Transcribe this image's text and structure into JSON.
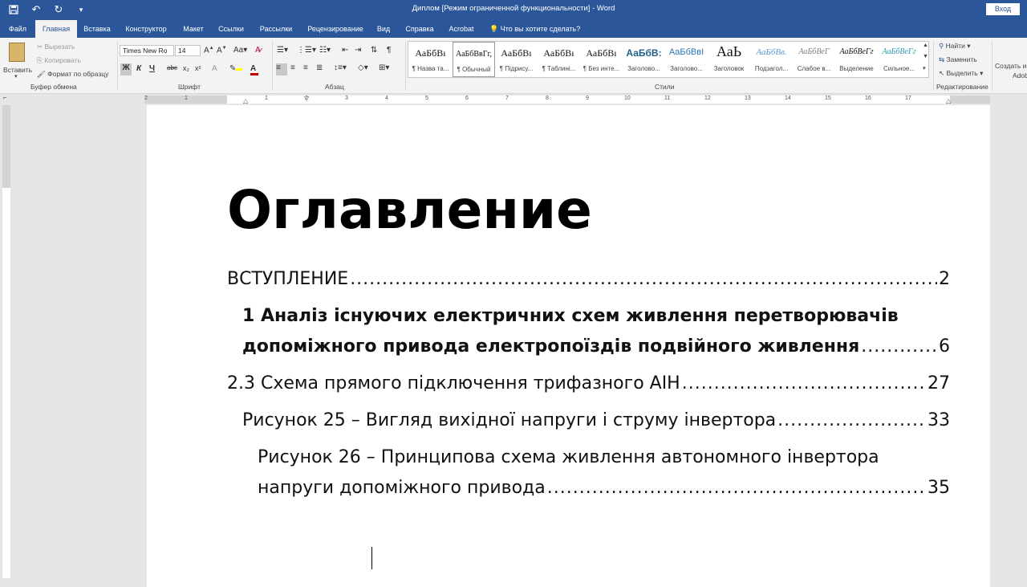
{
  "window": {
    "title": "Диплом [Режим ограниченной функциональности]  -  Word",
    "signin": "Вход"
  },
  "tabs": [
    "Файл",
    "Главная",
    "Вставка",
    "Конструктор",
    "Макет",
    "Ссылки",
    "Рассылки",
    "Рецензирование",
    "Вид",
    "Справка",
    "Acrobat"
  ],
  "tell_me": "Что вы хотите сделать?",
  "ribbon": {
    "clipboard": {
      "paste": "Вставить",
      "cut": "Вырезать",
      "copy": "Копировать",
      "format_painter": "Формат по образцу",
      "label": "Буфер обмена"
    },
    "font": {
      "name": "Times New Ro",
      "size": "14",
      "case": "Aa",
      "bold": "Ж",
      "italic": "К",
      "underline": "Ч",
      "strike": "abc",
      "sub": "x₂",
      "sup": "x²",
      "label": "Шрифт"
    },
    "paragraph": {
      "label": "Абзац"
    },
    "styles": {
      "label": "Стили",
      "items": [
        {
          "sample": "АаБбВı",
          "name": "¶ Назва та..."
        },
        {
          "sample": "АаБбВвГг,",
          "name": "¶ Обычный"
        },
        {
          "sample": "АаБбВı",
          "name": "¶ Підрису..."
        },
        {
          "sample": "АаБбВı",
          "name": "¶ Таблині..."
        },
        {
          "sample": "АаБбВı",
          "name": "¶ Без инте..."
        },
        {
          "sample": "АаБбВ:",
          "name": "Заголово..."
        },
        {
          "sample": "АаБбВвI",
          "name": "Заголово..."
        },
        {
          "sample": "АаЬ",
          "name": "Заголовок"
        },
        {
          "sample": "АаБбВв.",
          "name": "Подзагол..."
        },
        {
          "sample": "АаБбВеГ",
          "name": "Слабое в..."
        },
        {
          "sample": "АаБбВеГг",
          "name": "Выделение"
        },
        {
          "sample": "АаБбВеГг",
          "name": "Сильное..."
        }
      ]
    },
    "editing": {
      "find": "Найти",
      "replace": "Заменить",
      "select": "Выделить",
      "label": "Редактирование"
    },
    "create": "Создать и",
    "create2": "Adob"
  },
  "ruler_numbers": [
    "2",
    "1",
    "1",
    "2",
    "3",
    "4",
    "5",
    "6",
    "7",
    "8",
    "9",
    "10",
    "11",
    "12",
    "13",
    "14",
    "15",
    "16",
    "17"
  ],
  "document": {
    "heading": "Оглавление",
    "toc": [
      {
        "text": "ВСТУПЛЕНИЕ",
        "page": "2"
      },
      {
        "text1": "1 Аналіз існуючих електричних схем живлення перетворювачів",
        "text2": "допоміжного привода електропоїздів подвійного живлення",
        "page": "6"
      },
      {
        "text": "2.3 Схема прямого підключення трифазного АІН",
        "page": "27"
      },
      {
        "text": "Рисунок 25 – Вигляд вихідної напруги і струму інвертора",
        "page": "33"
      },
      {
        "text1": "Рисунок 26 – Принципова схема живлення автономного інвертора",
        "text2": "напруги допоміжного привода",
        "page": "35"
      }
    ]
  }
}
